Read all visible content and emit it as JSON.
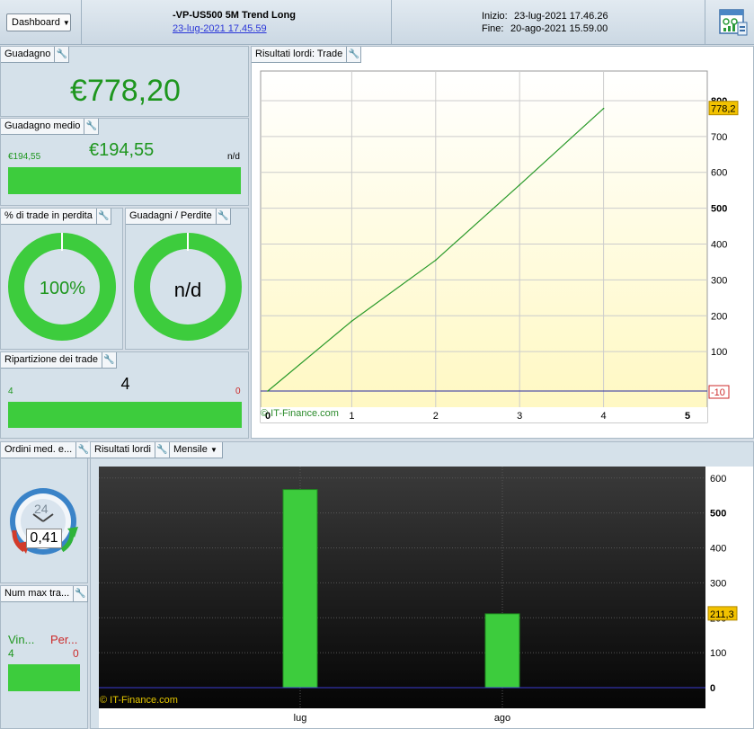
{
  "header": {
    "dashboard_label": "Dashboard",
    "strategy_name": "-VP-US500 5M Trend Long",
    "strategy_date": "23-lug-2021 17.45.59",
    "start_label": "Inizio:",
    "start_value": "23-lug-2021 17.46.26",
    "end_label": "Fine:",
    "end_value": "20-ago-2021 15.59.00"
  },
  "gain": {
    "title": "Guadagno",
    "value": "€778,20"
  },
  "avg_gain": {
    "title": "Guadagno medio",
    "value": "€194,55",
    "left": "€194,55",
    "right": "n/d",
    "fill": 1.0
  },
  "losing_trades": {
    "title": "% di trade in perdita",
    "value": "100%",
    "fill": 1.0
  },
  "gain_loss": {
    "title": "Guadagni / Perdite",
    "value": "n/d",
    "fill": 1.0
  },
  "trade_split": {
    "title": "Ripartizione dei trade",
    "total": "4",
    "wins": "4",
    "losses": "0",
    "fill": 1.0
  },
  "orders": {
    "title": "Ordini med. e...",
    "dial_value": "0,41",
    "dial_label": "24"
  },
  "max_trades": {
    "title": "Num max tra...",
    "win_label": "Vin...",
    "loss_label": "Per...",
    "wins": "4",
    "losses": "0",
    "fill": 1.0
  },
  "colors": {
    "accent_green": "#3dcc3d",
    "text_green": "#1e961e",
    "loss_red": "#cc2a2a",
    "value_tag": "#f2c200"
  },
  "line_chart": {
    "title": "Risultati lordi: Trade",
    "watermark": "© IT-Finance.com",
    "last_tag": "778,2",
    "zero_tag": "-10",
    "chart_data": {
      "type": "line",
      "x": [
        0,
        1,
        2,
        3,
        4
      ],
      "y": [
        -10,
        185,
        355,
        565,
        778.2
      ],
      "xlim": [
        0,
        5
      ],
      "ylim": [
        -10,
        820
      ],
      "x_ticks": [
        "0",
        "1",
        "2",
        "3",
        "4",
        "5"
      ],
      "y_ticks": [
        "100",
        "200",
        "300",
        "400",
        "500",
        "600",
        "700",
        "800"
      ],
      "grid": true
    }
  },
  "bar_chart": {
    "title": "Risultati lordi",
    "period": "Mensile",
    "watermark": "© IT-Finance.com",
    "last_tag": "211,3",
    "chart_data": {
      "type": "bar",
      "categories": [
        "lug",
        "ago"
      ],
      "values": [
        567,
        211.3
      ],
      "ylim": [
        0,
        620
      ],
      "y_ticks": [
        "0",
        "100",
        "200",
        "300",
        "400",
        "500",
        "600"
      ],
      "grid": true
    }
  }
}
